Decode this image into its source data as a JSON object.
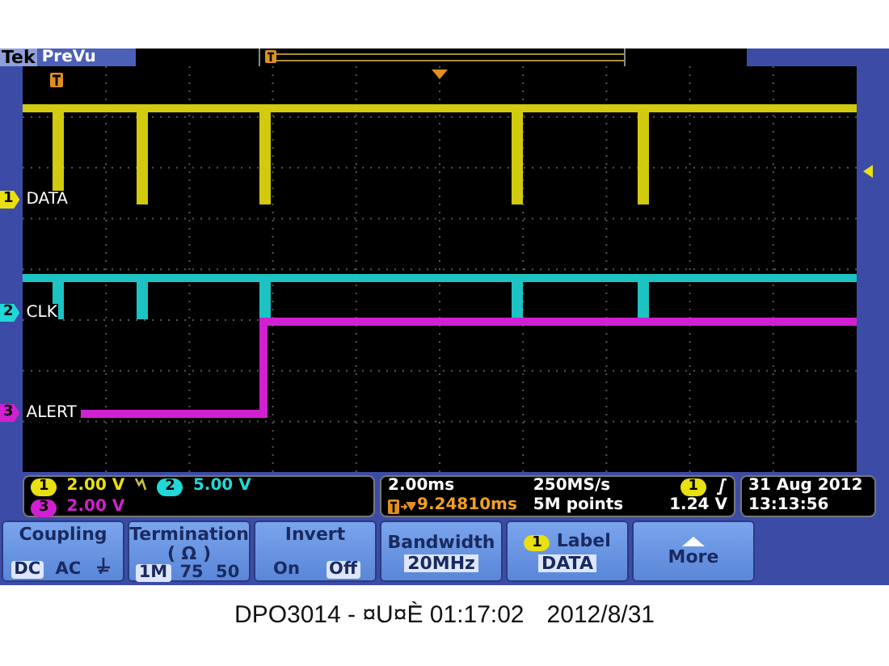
{
  "header": {
    "brand": "Tek",
    "mode": "PreVu"
  },
  "channels": [
    {
      "number": "1",
      "label": "DATA",
      "color": "#e8e010"
    },
    {
      "number": "2",
      "label": "CLK",
      "color": "#20d8d8"
    },
    {
      "number": "3",
      "label": "ALERT",
      "color": "#d020d0"
    }
  ],
  "readouts": [
    {
      "number": "1",
      "scale": "2.00 V",
      "color": "#e8e010"
    },
    {
      "number": "2",
      "scale": "5.00 V",
      "color": "#20d8d8"
    },
    {
      "number": "3",
      "scale": "2.00 V",
      "color": "#d020d0"
    }
  ],
  "horizontal": {
    "scale": "2.00ms",
    "delay": "9.24810ms",
    "sample_rate": "250MS/s",
    "record_length": "5M points"
  },
  "trigger": {
    "source": "1",
    "level": "1.24 V"
  },
  "clock": {
    "date": "31 Aug 2012",
    "time": "13:13:56"
  },
  "menu": [
    {
      "kind": "options",
      "title": "Coupling",
      "options": [
        {
          "kind": "text",
          "label": "DC",
          "selected": true
        },
        {
          "kind": "text",
          "label": "AC",
          "selected": false
        },
        {
          "kind": "ground",
          "selected": false
        }
      ]
    },
    {
      "kind": "options",
      "title": "Termination",
      "subtitle": "( Ω )",
      "options": [
        {
          "kind": "text",
          "label": "1M",
          "selected": true
        },
        {
          "kind": "text",
          "label": "75",
          "selected": false
        },
        {
          "kind": "text",
          "label": "50",
          "selected": false
        }
      ]
    },
    {
      "kind": "options",
      "title": "Invert",
      "options": [
        {
          "kind": "text",
          "label": "On",
          "selected": false
        },
        {
          "kind": "text",
          "label": "Off",
          "selected": true
        }
      ]
    },
    {
      "kind": "value",
      "title": "Bandwidth",
      "value": "20MHz"
    },
    {
      "kind": "badge",
      "badge": "1",
      "title": "Label",
      "value": "DATA"
    },
    {
      "kind": "more",
      "title": "More"
    }
  ],
  "caption": {
    "text": "DPO3014 - ¤U¤È 01:17:02",
    "date": "2012/8/31"
  }
}
